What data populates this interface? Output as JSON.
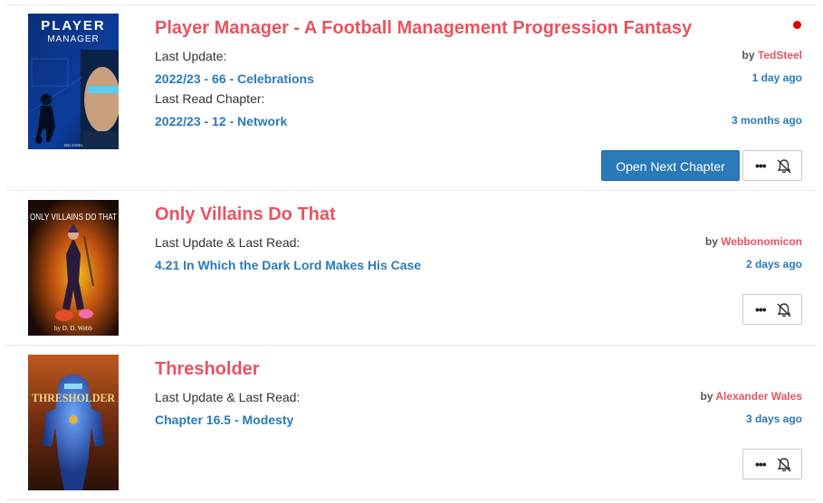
{
  "items": [
    {
      "title": "Player Manager - A Football Management Progression Fantasy",
      "cover_text_1": "PLAYER",
      "cover_text_2": "MANAGER",
      "cover_author": "TED STEEL",
      "line1_label": "Last Update:",
      "line1_chapter": "2022/23 - 66 - Celebrations",
      "line2_label": "Last Read Chapter:",
      "line2_chapter": "2022/23 - 12 - Network",
      "by": "by",
      "author": "TedSteel",
      "time1": "1 day ago",
      "time2": "3 months ago",
      "unread": true,
      "open_next_label": "Open Next Chapter"
    },
    {
      "title": "Only Villains Do That",
      "cover_text_1": "ONLY VILLAINS DO THAT",
      "cover_author": "by D. D. Webb",
      "line1_label": "Last Update & Last Read:",
      "line1_chapter": "4.21 In Which the Dark Lord Makes His Case",
      "by": "by",
      "author": "Webbonomicon",
      "time1": "2 days ago"
    },
    {
      "title": "Thresholder",
      "cover_text_1": "THRESHOLDER",
      "line1_label": "Last Update & Last Read:",
      "line1_chapter": "Chapter 16.5 - Modesty",
      "by": "by",
      "author": "Alexander Wales",
      "time1": "3 days ago"
    }
  ],
  "icons": {
    "more": "ellipsis-icon",
    "notify": "bell-slash-icon"
  },
  "colors": {
    "title": "#e8535f",
    "link": "#2a7ab8",
    "primary_button": "#2a7ab8",
    "unread_dot": "#e00000"
  }
}
